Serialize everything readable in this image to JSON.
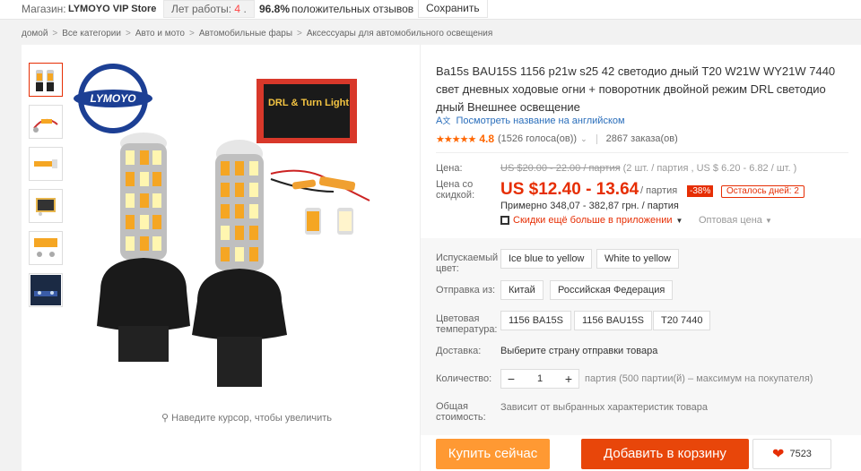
{
  "topbar": {
    "store_label": "Магазин:",
    "store_name": "LYMOYO VIP Store",
    "years_label": "Лет работы:",
    "years_value": "4",
    "positive_pct": "96.8%",
    "positive_label": "положительных отзывов",
    "save_label": "Сохранить"
  },
  "breadcrumbs": [
    "домой",
    "Все категории",
    "Авто и мото",
    "Автомобильные фары",
    "Аксессуары для автомобильного освещения"
  ],
  "gallery": {
    "brand_logo_text": "LYMOYO",
    "box_text": "DRL & Turn Light",
    "zoom_hint": "Наведите курсор, чтобы увеличить"
  },
  "product": {
    "title": "Ba15s BAU15S 1156 p21w s25 42 светодио дный T20 W21W WY21W 7440 свет дневных ходовые огни + поворотник двойной режим DRL светодио дный Внешнее освещение",
    "translate_link": "Посмотреть название на английском",
    "rating": "4.8",
    "votes": "(1526 голоса(ов))",
    "orders": "2867 заказа(ов)"
  },
  "pricing": {
    "price_label": "Цена:",
    "old_price": "US $20.00 - 22.00 / партия",
    "old_price_extra": "(2 шт. / партия , US $ 6.20 - 6.82 / шт. )",
    "discount_label_1": "Цена со",
    "discount_label_2": "скидкой:",
    "price": "US $12.40 - 13.64",
    "price_unit": "/ партия",
    "discount_pct": "-38%",
    "days_left": "Осталось дней: 2",
    "approx": "Примерно 348,07 - 382,87 грн. / партия",
    "app_discount": "Скидки ещё больше в приложении",
    "wholesale": "Оптовая цена"
  },
  "options": {
    "color_label_1": "Испускаемый",
    "color_label_2": "цвет:",
    "colors": [
      "Ice blue to yellow",
      "White to yellow"
    ],
    "ship_from_label": "Отправка из:",
    "ship_from": [
      "Китай",
      "Российская Федерация"
    ],
    "temp_label_1": "Цветовая",
    "temp_label_2": "температура:",
    "temps": [
      "1156 BA15S",
      "1156 BAU15S",
      "T20 7440"
    ],
    "delivery_label": "Доставка:",
    "delivery_value": "Выберите страну отправки товара",
    "qty_label": "Количество:",
    "qty_minus": "−",
    "qty_value": "1",
    "qty_plus": "+",
    "qty_note": "партия (500 партии(й) – максимум на покупателя)",
    "total_label_1": "Общая",
    "total_label_2": "стоимость:",
    "total_value": "Зависит от выбранных характеристик товара"
  },
  "actions": {
    "buy_now": "Купить сейчас",
    "add_to_cart": "Добавить в корзину",
    "wishlist_count": "7523"
  }
}
